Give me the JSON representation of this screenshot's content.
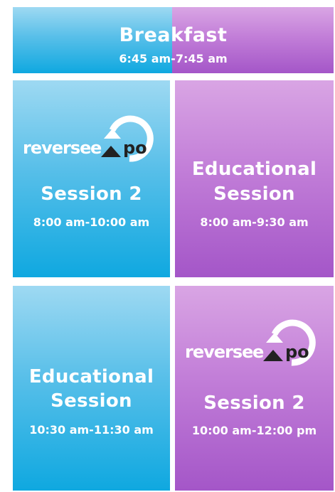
{
  "breakfast": {
    "title": "Breakfast",
    "time": "6:45 am-7:45 am"
  },
  "cells": {
    "top_left": {
      "logo_text": "reverseexpo",
      "title": "Session 2",
      "time": "8:00 am-10:00 am"
    },
    "top_right": {
      "title_line1": "Educational",
      "title_line2": "Session",
      "time": "8:00 am-9:30 am"
    },
    "bottom_left": {
      "title_line1": "Educational",
      "title_line2": "Session",
      "time": "10:30 am-11:30 am"
    },
    "bottom_right": {
      "logo_text": "reverseexpo",
      "title": "Session 2",
      "time": "10:00 am-12:00 pm"
    }
  },
  "colors": {
    "blue": "#0fa8e0",
    "purple": "#a456c8",
    "text": "#ffffff"
  },
  "icons": {
    "logo": "reverse-expo-logo-icon"
  }
}
